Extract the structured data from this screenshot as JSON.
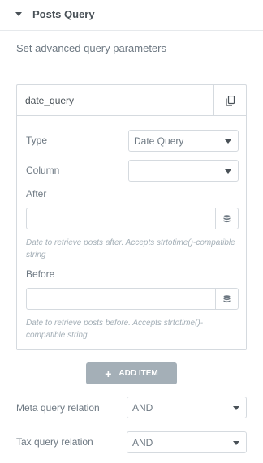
{
  "section": {
    "title": "Posts Query",
    "description": "Set advanced query parameters"
  },
  "repeater": {
    "item_title": "date_query",
    "fields": {
      "type": {
        "label": "Type",
        "value": "Date Query"
      },
      "column": {
        "label": "Column",
        "value": ""
      },
      "after": {
        "label": "After",
        "value": "",
        "help": "Date to retrieve posts after. Accepts strtotime()-compatible string"
      },
      "before": {
        "label": "Before",
        "value": "",
        "help": "Date to retrieve posts before. Accepts strtotime()-compatible string"
      }
    }
  },
  "add_item_label": "ADD ITEM",
  "meta_query": {
    "label": "Meta query relation",
    "value": "AND"
  },
  "tax_query": {
    "label": "Tax query relation",
    "value": "AND"
  },
  "icons": {
    "section_toggle": "caret-down-icon",
    "duplicate": "copy-icon",
    "dynamic_tags": "database-icon",
    "add": "plus-icon",
    "select_arrow": "chevron-down-icon"
  }
}
